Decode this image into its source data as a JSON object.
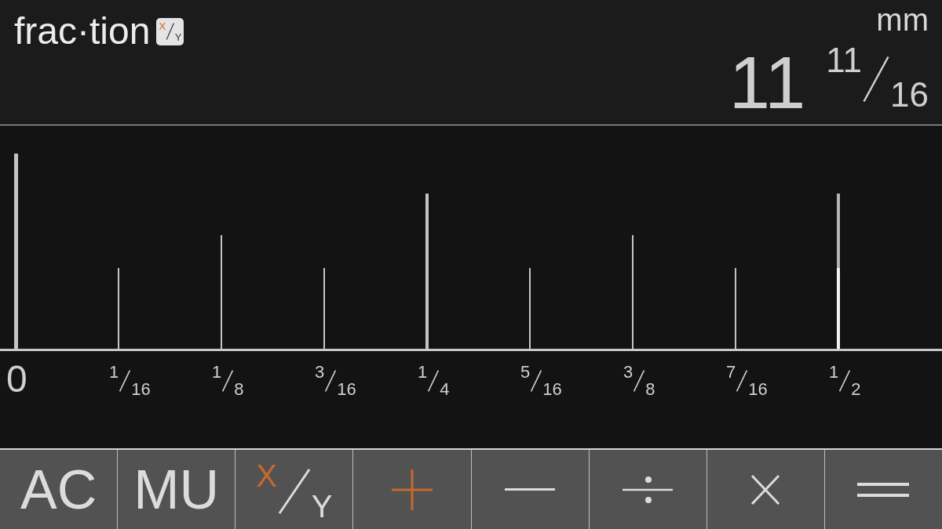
{
  "app": {
    "name": "frac·tion",
    "badge_numerator": "X",
    "badge_denominator": "Y"
  },
  "display": {
    "unit": "mm",
    "whole": "11",
    "numerator": "11",
    "denominator": "16"
  },
  "ruler": {
    "ticks": [
      {
        "kind": "whole",
        "value": "0"
      },
      {
        "kind": "sixteenth",
        "numerator": "1",
        "denominator": "16"
      },
      {
        "kind": "eighth",
        "numerator": "1",
        "denominator": "8"
      },
      {
        "kind": "sixteenth",
        "numerator": "3",
        "denominator": "16"
      },
      {
        "kind": "quarter",
        "numerator": "1",
        "denominator": "4"
      },
      {
        "kind": "sixteenth",
        "numerator": "5",
        "denominator": "16"
      },
      {
        "kind": "eighth",
        "numerator": "3",
        "denominator": "8"
      },
      {
        "kind": "sixteenth",
        "numerator": "7",
        "denominator": "16"
      },
      {
        "kind": "half",
        "numerator": "1",
        "denominator": "2"
      }
    ]
  },
  "keys": [
    {
      "kind": "text",
      "label": "AC",
      "selected": false
    },
    {
      "kind": "text",
      "label": "MU",
      "selected": false
    },
    {
      "kind": "fraction",
      "numerator": "X",
      "denominator": "Y",
      "selected": false
    },
    {
      "kind": "plus",
      "selected": true
    },
    {
      "kind": "minus",
      "selected": false
    },
    {
      "kind": "divide",
      "selected": false
    },
    {
      "kind": "multiply",
      "selected": false
    },
    {
      "kind": "equals",
      "selected": false
    }
  ]
}
